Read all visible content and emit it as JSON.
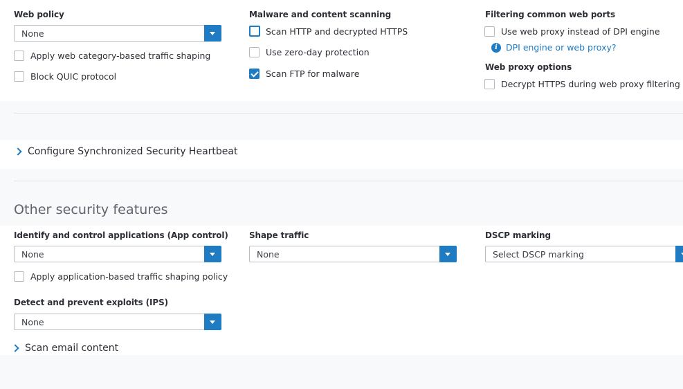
{
  "web_policy": {
    "label": "Web policy",
    "select_value": "None",
    "traffic_shaping_label": "Apply web category-based traffic shaping",
    "traffic_shaping_checked": false,
    "block_quic_label": "Block QUIC protocol",
    "block_quic_checked": false
  },
  "malware_scanning": {
    "label": "Malware and content scanning",
    "scan_http_label": "Scan HTTP and decrypted HTTPS",
    "scan_http_checked": false,
    "zero_day_label": "Use zero-day protection",
    "zero_day_checked": false,
    "scan_ftp_label": "Scan FTP for malware",
    "scan_ftp_checked": true
  },
  "web_ports": {
    "label": "Filtering common web ports",
    "web_proxy_label": "Use web proxy instead of DPI engine",
    "web_proxy_checked": false,
    "info_link": "DPI engine or web proxy?"
  },
  "web_proxy_options": {
    "label": "Web proxy options",
    "decrypt_label": "Decrypt HTTPS during web proxy filtering",
    "decrypt_checked": false
  },
  "heartbeat": {
    "label": "Configure Synchronized Security Heartbeat"
  },
  "other_security": {
    "title": "Other security features",
    "app_control": {
      "label": "Identify and control applications (App control)",
      "select_value": "None",
      "shaping_label": "Apply application-based traffic shaping policy",
      "shaping_checked": false
    },
    "shape_traffic": {
      "label": "Shape traffic",
      "select_value": "None"
    },
    "dscp": {
      "label": "DSCP marking",
      "select_placeholder": "Select DSCP marking"
    },
    "ips": {
      "label": "Detect and prevent exploits (IPS)",
      "select_value": "None"
    },
    "scan_email": {
      "label": "Scan email content"
    }
  },
  "colors": {
    "accent": "#1f7bc2",
    "panel_bg": "#ffffff",
    "page_bg": "#f8f9fb",
    "divider": "#dfe2e7"
  },
  "icons": {
    "select_arrow": "caret-down-icon",
    "info": "info-icon",
    "expand": "chevron-right-icon",
    "checkmark": "checkmark-icon"
  }
}
